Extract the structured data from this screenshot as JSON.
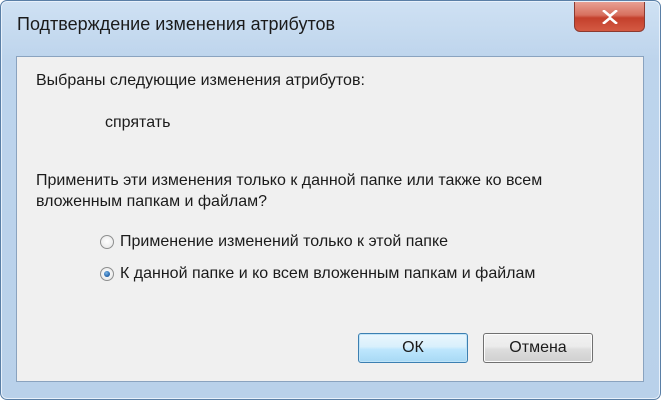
{
  "window": {
    "title": "Подтверждение изменения атрибутов",
    "close_icon": "close-icon"
  },
  "content": {
    "intro": "Выбраны следующие изменения атрибутов:",
    "change": "спрятать",
    "question_line1": "Применить эти изменения только к данной папке или также ко всем",
    "question_line2": "вложенным папкам и файлам?"
  },
  "options": [
    {
      "label": "Применение изменений только к этой папке",
      "checked": false
    },
    {
      "label": "К данной папке и ко всем вложенным папкам и файлам",
      "checked": true
    }
  ],
  "buttons": {
    "ok_label": "ОК",
    "cancel_label": "Отмена"
  },
  "colors": {
    "frame": "#bdd4ec",
    "client": "#f0f0f0",
    "close_button": "#c4402c",
    "default_button_border": "#3c7fb1"
  }
}
